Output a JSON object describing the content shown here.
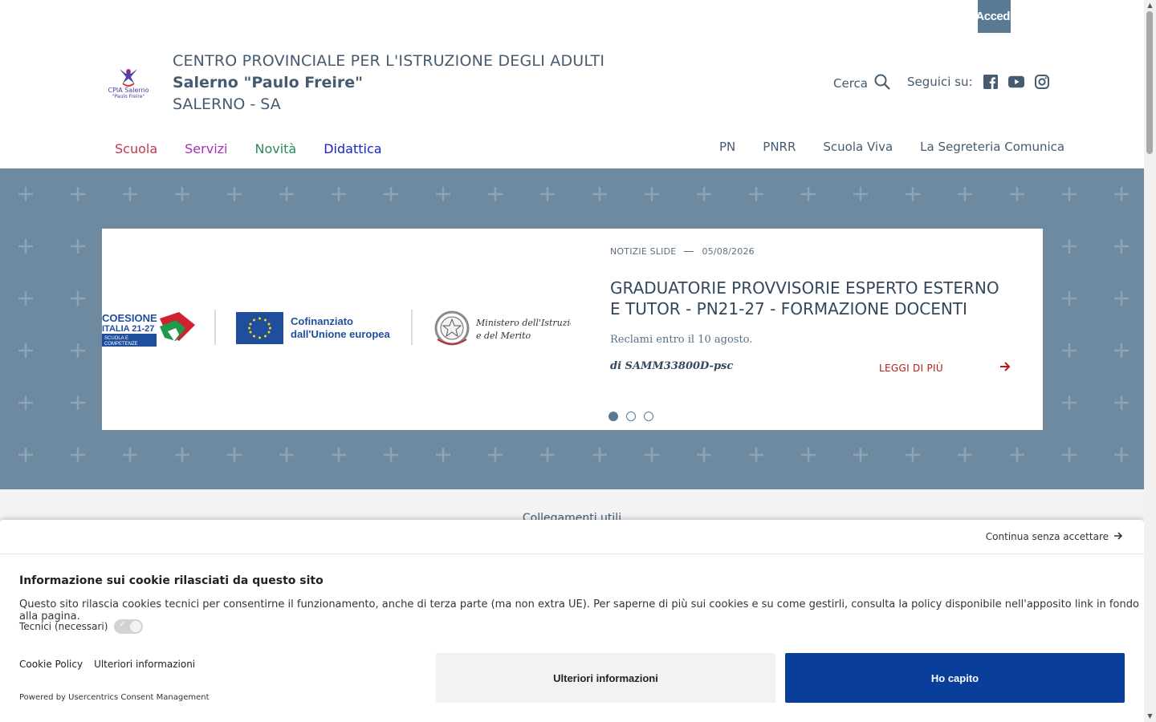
{
  "topbar": {
    "login_label": "Accedi"
  },
  "header": {
    "logo_text_line1": "CPIA Salerno",
    "logo_text_line2": "\"Paulo Freire\"",
    "brand_line1": "CENTRO PROVINCIALE PER L'ISTRUZIONE DEGLI ADULTI",
    "brand_line2": "Salerno \"Paulo Freire\"",
    "brand_line3": "SALERNO - SA",
    "search_label": "Cerca",
    "social_label": "Seguici su:",
    "social_icons": [
      "facebook-icon",
      "youtube-icon",
      "instagram-icon"
    ]
  },
  "mainnav": [
    {
      "label": "Scuola",
      "color": "#c4364c"
    },
    {
      "label": "Servizi",
      "color": "#a632b8"
    },
    {
      "label": "Novità",
      "color": "#2a8a5a"
    },
    {
      "label": "Didattica",
      "color": "#1a23c8"
    }
  ],
  "secnav": [
    "PN",
    "PNRR",
    "Scuola Viva",
    "La Segreteria Comunica"
  ],
  "hero": {
    "background": "#6e8aa0",
    "image": {
      "logo1_title": "COESIONE",
      "logo1_sub": "ITALIA 21-27",
      "logo1_tag1": "SCUOLA E",
      "logo1_tag2": "COMPETENZE",
      "eu_line1": "Cofinanziato",
      "eu_line2": "dall'Unione europea",
      "ministry_line1": "Ministero dell'Istruzione",
      "ministry_line2": "e del Merito"
    },
    "category": "NOTIZIE SLIDE",
    "date": "05/08/2026",
    "title": "GRADUATORIE PROVVISORIE ESPERTO ESTERNO E TUTOR - PN21-27 - FORMAZIONE DOCENTI",
    "text": "Reclami entro il 10 agosto.",
    "author": "di SAMM33800D-psc",
    "readmore": "LEGGI DI PIÙ",
    "slides": 3,
    "active_slide": 1
  },
  "links": {
    "title": "Collegamenti utili"
  },
  "cookie": {
    "continue_label": "Continua senza accettare",
    "title": "Informazione sui cookie rilasciati da questo sito",
    "text": "Questo sito rilascia cookies tecnici per consentirne il funzionamento, anche di terza parte (ma non extra UE). Per saperne di più sui cookies e su come gestirli, consulta la policy disponibile nell'apposito link in fondo alla pagina.",
    "toggle_label": "Tecnici (necessari)",
    "link_policy": "Cookie Policy",
    "link_more": "Ulteriori informazioni",
    "powered": "Powered by Usercentrics Consent Management",
    "btn_more": "Ulteriori informazioni",
    "btn_ok": "Ho capito",
    "ok_color": "#0a3e9b"
  }
}
